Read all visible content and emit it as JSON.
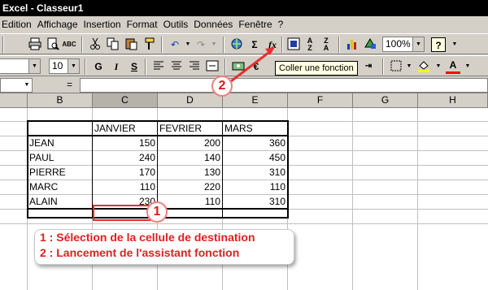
{
  "window": {
    "title": "Excel - Classeur1"
  },
  "menu": [
    "Edition",
    "Affichage",
    "Insertion",
    "Format",
    "Outils",
    "Données",
    "Fenêtre",
    "?"
  ],
  "toolbar1": {
    "zoom": "100%",
    "icons": [
      "print-icon",
      "print-preview-icon",
      "spelling-icon",
      "cut-icon",
      "copy-icon",
      "paste-icon",
      "format-painter-icon",
      "undo-icon",
      "redo-icon",
      "hyperlink-icon",
      "autosum-icon",
      "paste-function-icon",
      "sort-ascending-icon",
      "sort-descending-icon",
      "chart-wizard-icon",
      "map-icon",
      "help-icon"
    ],
    "autosum_glyph": "Σ",
    "fx_glyph": "fx"
  },
  "toolbar2": {
    "font_size": "10",
    "bold": "G",
    "italic": "I",
    "underline": "S",
    "currency": "€",
    "font_color_glyph": "A"
  },
  "tooltip": "Coller une fonction",
  "formula_bar": {
    "name_box": "",
    "equals": "=",
    "content": ""
  },
  "columns": [
    "B",
    "C",
    "D",
    "E",
    "F",
    "G",
    "H"
  ],
  "table": {
    "headers": [
      "",
      "JANVIER",
      "FEVRIER",
      "MARS"
    ],
    "rows": [
      {
        "name": "JEAN",
        "values": [
          "150",
          "200",
          "360"
        ]
      },
      {
        "name": "PAUL",
        "values": [
          "240",
          "140",
          "450"
        ]
      },
      {
        "name": "PIERRE",
        "values": [
          "170",
          "130",
          "310"
        ]
      },
      {
        "name": "MARC",
        "values": [
          "110",
          "220",
          "110"
        ]
      },
      {
        "name": "ALAIN",
        "values": [
          "230",
          "110",
          "310"
        ]
      }
    ]
  },
  "annotations": {
    "badge1": "1",
    "badge2": "2",
    "line1": "1 : Sélection de la cellule de destination",
    "line2": "2 : Lancement de l'assistant fonction",
    "accent_color": "#e02020"
  }
}
